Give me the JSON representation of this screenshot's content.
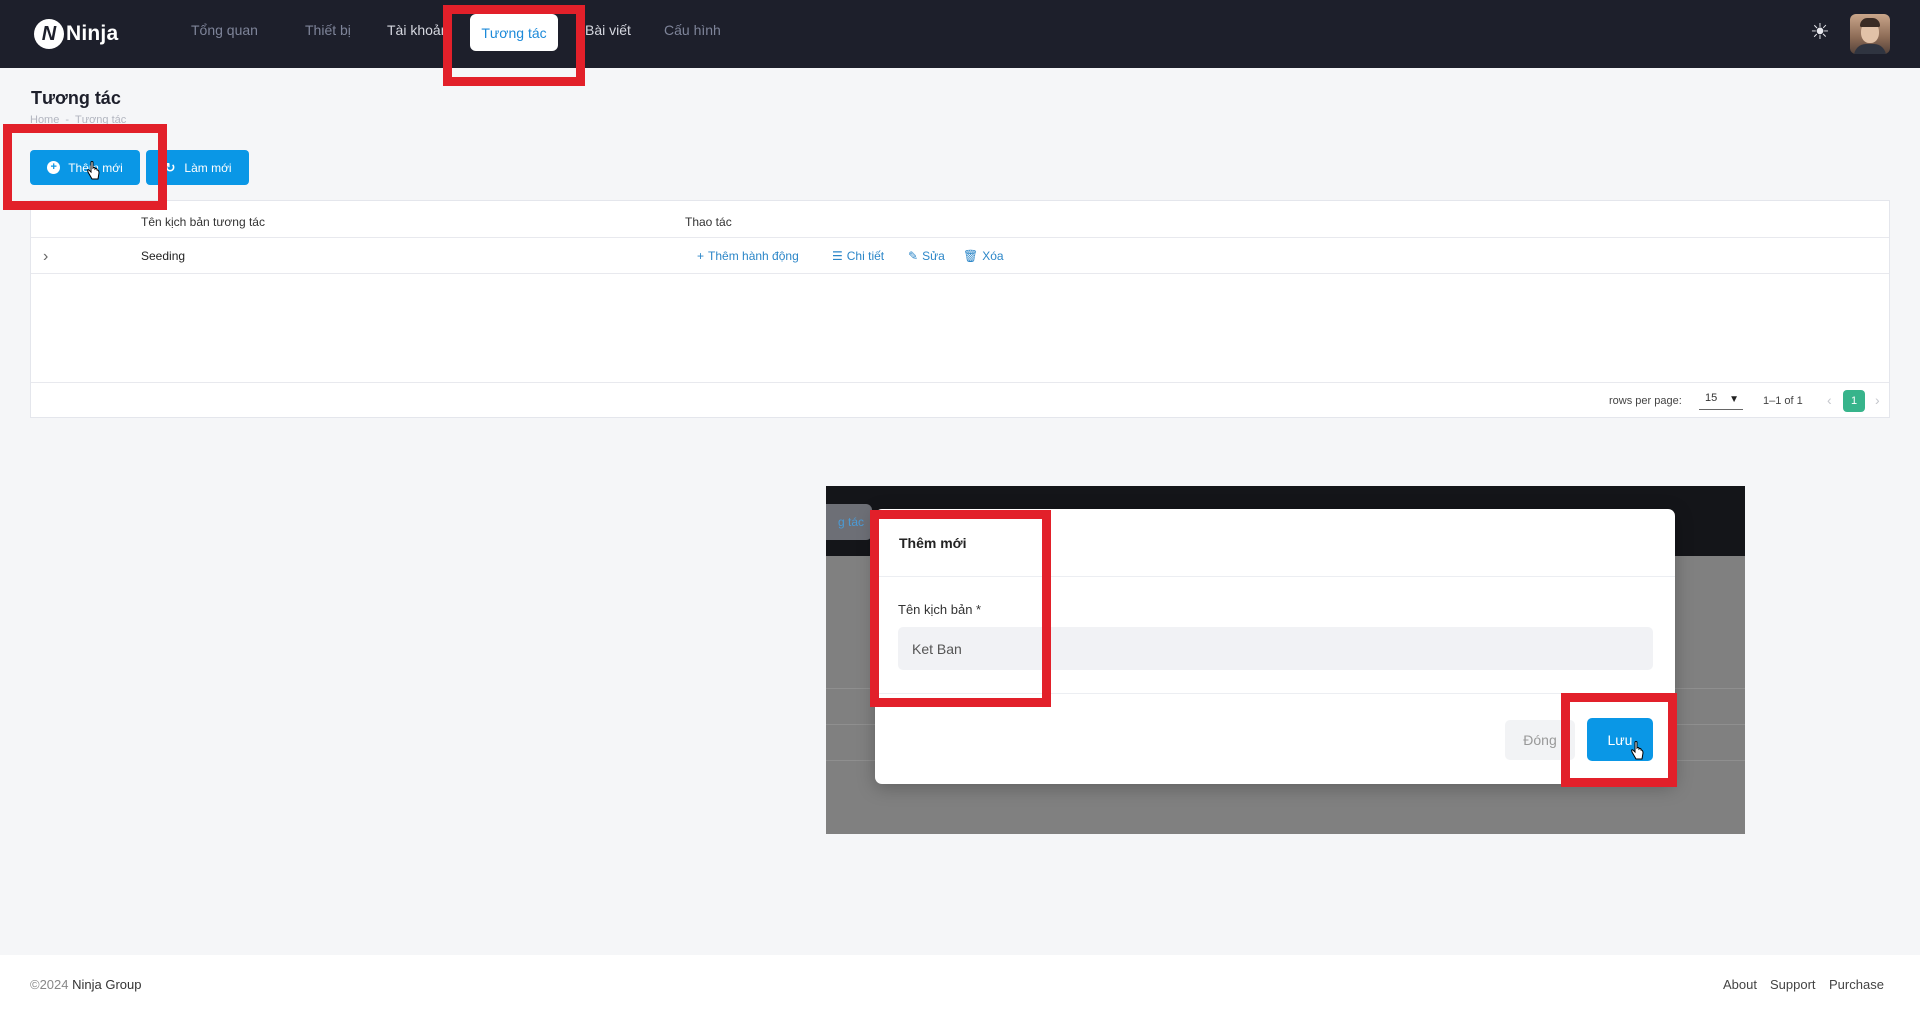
{
  "header": {
    "logo_text": "Ninja",
    "logo_mark": "N",
    "nav": [
      {
        "label": "Tổng quan"
      },
      {
        "label": "Thiết bị"
      },
      {
        "label": "Tài khoản"
      },
      {
        "label": "Tương tác",
        "active": true
      },
      {
        "label": "Bài viết"
      },
      {
        "label": "Cấu hình"
      }
    ],
    "theme_icon": "sun-icon"
  },
  "page": {
    "title": "Tương tác",
    "breadcrumb": [
      "Home",
      "-",
      "Tương tác"
    ],
    "buttons": {
      "add": "Thêm mới",
      "refresh": "Làm mới"
    }
  },
  "table": {
    "columns": [
      "Tên kịch bản tương tác",
      "Thao tác"
    ],
    "rows": [
      {
        "name": "Seeding"
      }
    ],
    "actions": {
      "add_action": "Thêm hành động",
      "detail": "Chi tiết",
      "edit": "Sửa",
      "delete": "Xóa"
    },
    "pagination": {
      "rows_per_page_label": "rows per page:",
      "rows_per_page_value": "15",
      "range": "1–1 of 1",
      "current_page": "1"
    }
  },
  "dialog": {
    "background_tab": "g tác",
    "title": "Thêm mới",
    "field_label": "Tên kịch bản *",
    "field_value": "Ket Ban",
    "close_label": "Đóng",
    "save_label": "Lưu"
  },
  "footer": {
    "copyright_prefix": "©2024",
    "company": "Ninja Group",
    "links": [
      "About",
      "Support",
      "Purchase"
    ]
  },
  "colors": {
    "accent": "#0a97e6",
    "highlight": "#e2202a",
    "topbar": "#1d1f2b",
    "page_badge": "#37b48b"
  }
}
